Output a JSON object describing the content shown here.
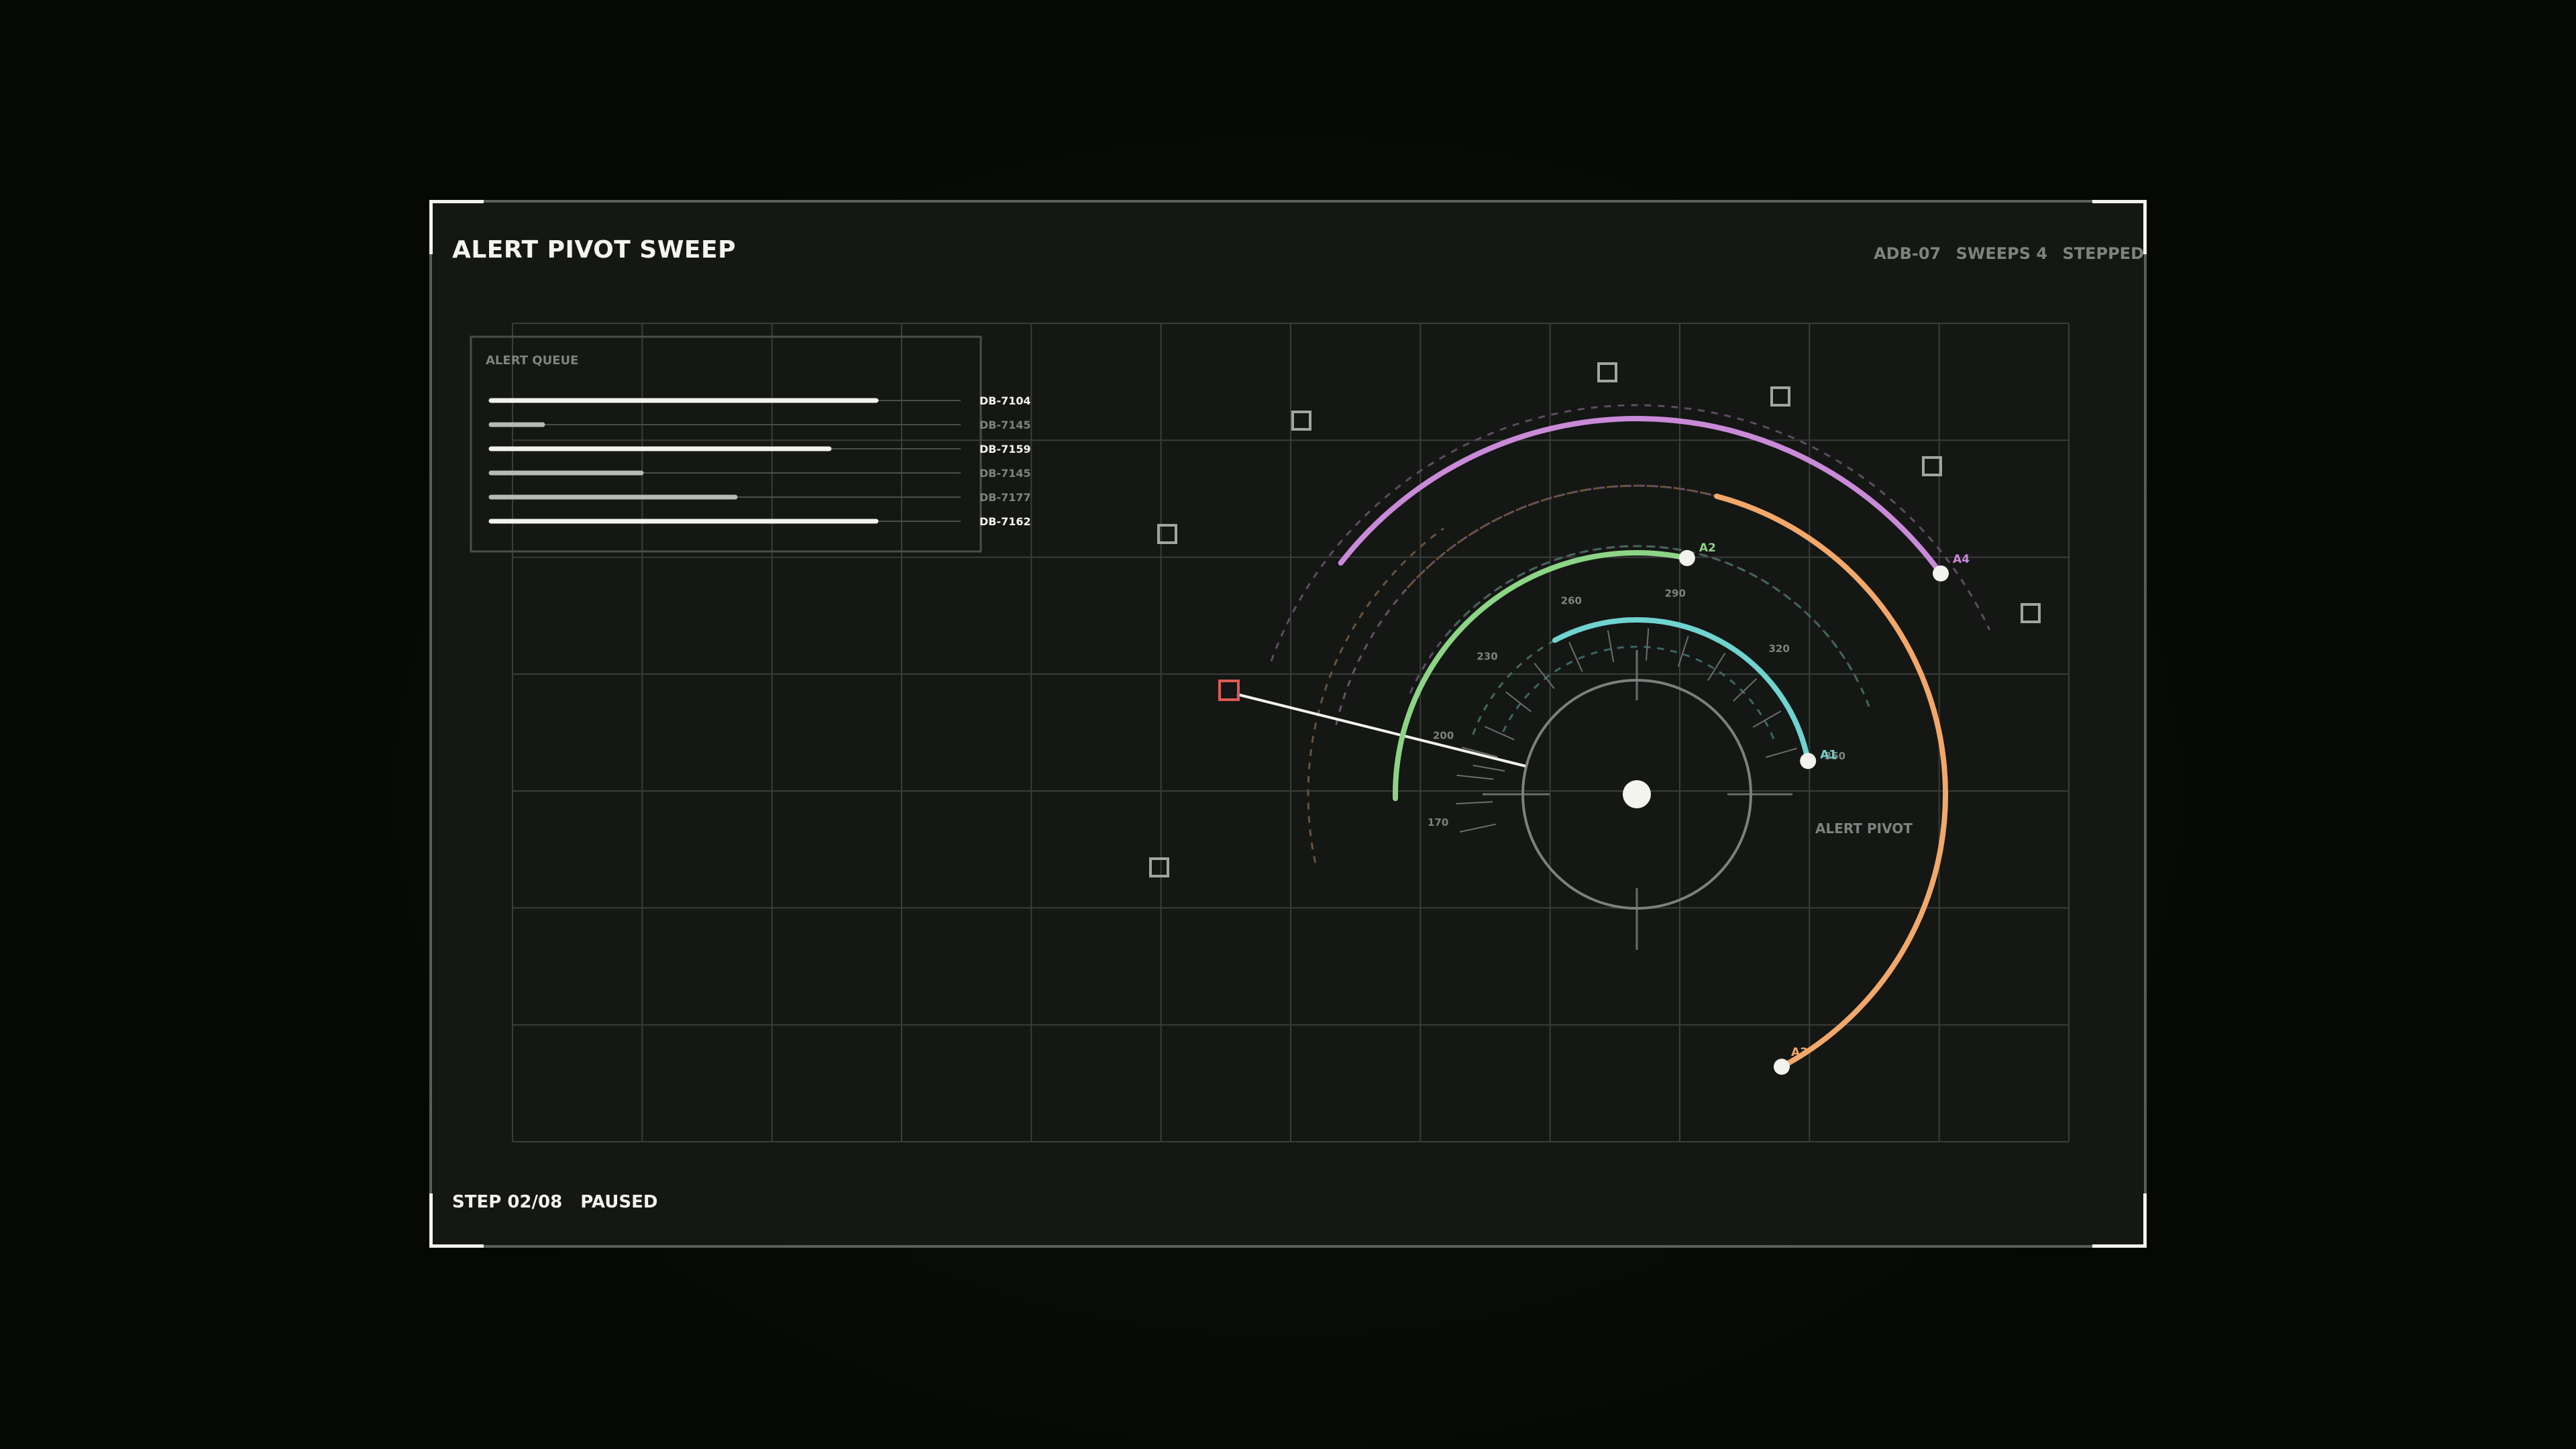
{
  "header": {
    "title": "ALERT PIVOT SWEEP",
    "device": "ADB-07",
    "sweeps": "SWEEPS 4",
    "mode": "STEPPED"
  },
  "footer": {
    "step": "STEP 02/08",
    "state": "PAUSED"
  },
  "queue": {
    "title": "ALERT QUEUE",
    "items": [
      {
        "id": "DB-7104",
        "level": 0.82,
        "active": true
      },
      {
        "id": "DB-7145",
        "level": 0.11,
        "active": false
      },
      {
        "id": "DB-7159",
        "level": 0.72,
        "active": true
      },
      {
        "id": "DB-7145",
        "level": 0.32,
        "active": false
      },
      {
        "id": "DB-7177",
        "level": 0.52,
        "active": false
      },
      {
        "id": "DB-7162",
        "level": 0.82,
        "active": true
      }
    ]
  },
  "pivot": {
    "label": "ALERT PIVOT",
    "tick_labels": [
      "170",
      "200",
      "230",
      "260",
      "290",
      "320",
      "350"
    ],
    "arcs": [
      {
        "id": "A1",
        "color": "#6fd3cf",
        "start_deg": 242,
        "end_deg": 349
      },
      {
        "id": "A2",
        "color": "#8dd486",
        "start_deg": 179,
        "end_deg": 282
      },
      {
        "id": "A3",
        "color": "#f2a86a",
        "start_deg": 285,
        "end_deg": 422
      },
      {
        "id": "A4",
        "color": "#c98ad8",
        "start_deg": 218,
        "end_deg": 324
      }
    ]
  },
  "colors": {
    "alert": "#e05a55",
    "grid": "#3b3e3b",
    "text_dim": "#7f827e"
  }
}
